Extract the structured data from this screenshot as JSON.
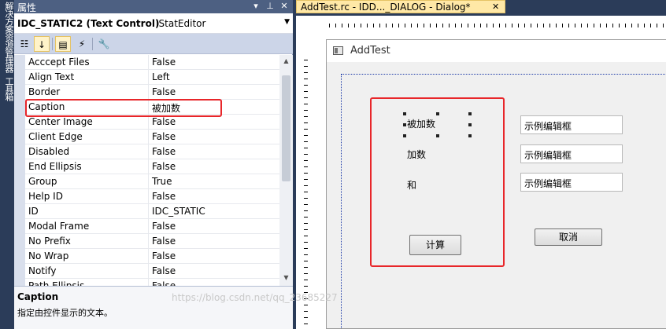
{
  "side_tabs": [
    "解决方案资源管理器",
    "工具箱"
  ],
  "properties": {
    "title": "属性",
    "title_icons": [
      "chevron-down-icon",
      "pin-icon",
      "close-icon"
    ],
    "object_name": "IDC_STATIC2 (Text Control)",
    "object_type": "IStatEditor",
    "toolbar": [
      "categorized-icon",
      "alphabetical-icon",
      "properties-icon",
      "events-icon",
      "property-pages-icon"
    ],
    "rows": [
      {
        "name": "Acccept Files",
        "value": "False"
      },
      {
        "name": "Align Text",
        "value": "Left"
      },
      {
        "name": "Border",
        "value": "False"
      },
      {
        "name": "Caption",
        "value": "被加数"
      },
      {
        "name": "Center Image",
        "value": "False"
      },
      {
        "name": "Client Edge",
        "value": "False"
      },
      {
        "name": "Disabled",
        "value": "False"
      },
      {
        "name": "End Ellipsis",
        "value": "False"
      },
      {
        "name": "Group",
        "value": "True"
      },
      {
        "name": "Help ID",
        "value": "False"
      },
      {
        "name": "ID",
        "value": "IDC_STATIC"
      },
      {
        "name": "Modal Frame",
        "value": "False"
      },
      {
        "name": "No Prefix",
        "value": "False"
      },
      {
        "name": "No Wrap",
        "value": "False"
      },
      {
        "name": "Notify",
        "value": "False"
      },
      {
        "name": "Path Ellipsis",
        "value": "False"
      }
    ],
    "selected_row": 3,
    "description": {
      "title": "Caption",
      "text": "指定由控件显示的文本。"
    }
  },
  "editor": {
    "tab_label": "AddTest.rc - IDD..._DIALOG - Dialog*",
    "tab_close": "✕",
    "dialog": {
      "title": "AddTest",
      "labels": [
        "被加数",
        "加数",
        "和"
      ],
      "edits": [
        "示例编辑框",
        "示例编辑框",
        "示例编辑框"
      ],
      "calc_button": "计算",
      "cancel_button": "取消"
    }
  },
  "watermark": "https://blog.csdn.net/qq_23685227",
  "colors": {
    "accent": "#e8262a",
    "titlebar": "#4d6082",
    "tab_active": "#ffe8a6"
  }
}
